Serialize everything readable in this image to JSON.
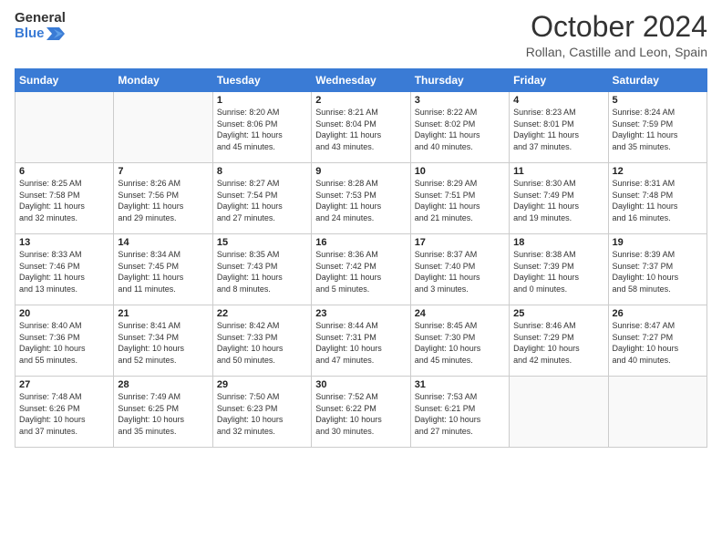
{
  "header": {
    "logo_line1": "General",
    "logo_line2": "Blue",
    "month": "October 2024",
    "location": "Rollan, Castille and Leon, Spain"
  },
  "days_of_week": [
    "Sunday",
    "Monday",
    "Tuesday",
    "Wednesday",
    "Thursday",
    "Friday",
    "Saturday"
  ],
  "weeks": [
    [
      {
        "day": "",
        "detail": ""
      },
      {
        "day": "",
        "detail": ""
      },
      {
        "day": "1",
        "detail": "Sunrise: 8:20 AM\nSunset: 8:06 PM\nDaylight: 11 hours\nand 45 minutes."
      },
      {
        "day": "2",
        "detail": "Sunrise: 8:21 AM\nSunset: 8:04 PM\nDaylight: 11 hours\nand 43 minutes."
      },
      {
        "day": "3",
        "detail": "Sunrise: 8:22 AM\nSunset: 8:02 PM\nDaylight: 11 hours\nand 40 minutes."
      },
      {
        "day": "4",
        "detail": "Sunrise: 8:23 AM\nSunset: 8:01 PM\nDaylight: 11 hours\nand 37 minutes."
      },
      {
        "day": "5",
        "detail": "Sunrise: 8:24 AM\nSunset: 7:59 PM\nDaylight: 11 hours\nand 35 minutes."
      }
    ],
    [
      {
        "day": "6",
        "detail": "Sunrise: 8:25 AM\nSunset: 7:58 PM\nDaylight: 11 hours\nand 32 minutes."
      },
      {
        "day": "7",
        "detail": "Sunrise: 8:26 AM\nSunset: 7:56 PM\nDaylight: 11 hours\nand 29 minutes."
      },
      {
        "day": "8",
        "detail": "Sunrise: 8:27 AM\nSunset: 7:54 PM\nDaylight: 11 hours\nand 27 minutes."
      },
      {
        "day": "9",
        "detail": "Sunrise: 8:28 AM\nSunset: 7:53 PM\nDaylight: 11 hours\nand 24 minutes."
      },
      {
        "day": "10",
        "detail": "Sunrise: 8:29 AM\nSunset: 7:51 PM\nDaylight: 11 hours\nand 21 minutes."
      },
      {
        "day": "11",
        "detail": "Sunrise: 8:30 AM\nSunset: 7:49 PM\nDaylight: 11 hours\nand 19 minutes."
      },
      {
        "day": "12",
        "detail": "Sunrise: 8:31 AM\nSunset: 7:48 PM\nDaylight: 11 hours\nand 16 minutes."
      }
    ],
    [
      {
        "day": "13",
        "detail": "Sunrise: 8:33 AM\nSunset: 7:46 PM\nDaylight: 11 hours\nand 13 minutes."
      },
      {
        "day": "14",
        "detail": "Sunrise: 8:34 AM\nSunset: 7:45 PM\nDaylight: 11 hours\nand 11 minutes."
      },
      {
        "day": "15",
        "detail": "Sunrise: 8:35 AM\nSunset: 7:43 PM\nDaylight: 11 hours\nand 8 minutes."
      },
      {
        "day": "16",
        "detail": "Sunrise: 8:36 AM\nSunset: 7:42 PM\nDaylight: 11 hours\nand 5 minutes."
      },
      {
        "day": "17",
        "detail": "Sunrise: 8:37 AM\nSunset: 7:40 PM\nDaylight: 11 hours\nand 3 minutes."
      },
      {
        "day": "18",
        "detail": "Sunrise: 8:38 AM\nSunset: 7:39 PM\nDaylight: 11 hours\nand 0 minutes."
      },
      {
        "day": "19",
        "detail": "Sunrise: 8:39 AM\nSunset: 7:37 PM\nDaylight: 10 hours\nand 58 minutes."
      }
    ],
    [
      {
        "day": "20",
        "detail": "Sunrise: 8:40 AM\nSunset: 7:36 PM\nDaylight: 10 hours\nand 55 minutes."
      },
      {
        "day": "21",
        "detail": "Sunrise: 8:41 AM\nSunset: 7:34 PM\nDaylight: 10 hours\nand 52 minutes."
      },
      {
        "day": "22",
        "detail": "Sunrise: 8:42 AM\nSunset: 7:33 PM\nDaylight: 10 hours\nand 50 minutes."
      },
      {
        "day": "23",
        "detail": "Sunrise: 8:44 AM\nSunset: 7:31 PM\nDaylight: 10 hours\nand 47 minutes."
      },
      {
        "day": "24",
        "detail": "Sunrise: 8:45 AM\nSunset: 7:30 PM\nDaylight: 10 hours\nand 45 minutes."
      },
      {
        "day": "25",
        "detail": "Sunrise: 8:46 AM\nSunset: 7:29 PM\nDaylight: 10 hours\nand 42 minutes."
      },
      {
        "day": "26",
        "detail": "Sunrise: 8:47 AM\nSunset: 7:27 PM\nDaylight: 10 hours\nand 40 minutes."
      }
    ],
    [
      {
        "day": "27",
        "detail": "Sunrise: 7:48 AM\nSunset: 6:26 PM\nDaylight: 10 hours\nand 37 minutes."
      },
      {
        "day": "28",
        "detail": "Sunrise: 7:49 AM\nSunset: 6:25 PM\nDaylight: 10 hours\nand 35 minutes."
      },
      {
        "day": "29",
        "detail": "Sunrise: 7:50 AM\nSunset: 6:23 PM\nDaylight: 10 hours\nand 32 minutes."
      },
      {
        "day": "30",
        "detail": "Sunrise: 7:52 AM\nSunset: 6:22 PM\nDaylight: 10 hours\nand 30 minutes."
      },
      {
        "day": "31",
        "detail": "Sunrise: 7:53 AM\nSunset: 6:21 PM\nDaylight: 10 hours\nand 27 minutes."
      },
      {
        "day": "",
        "detail": ""
      },
      {
        "day": "",
        "detail": ""
      }
    ]
  ]
}
